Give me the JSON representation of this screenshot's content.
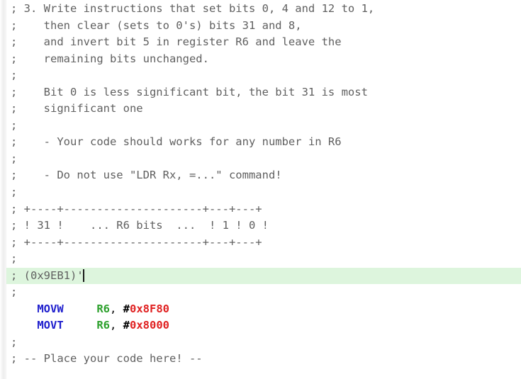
{
  "editor": {
    "name": "assembly-code-editor",
    "language": "ARM Assembly",
    "background_color": "#ffffff",
    "comment_color": "#606060",
    "mnemonic_color": "#1e1ecd",
    "register_color": "#2ca02c",
    "number_color": "#e02020",
    "current_line_highlight_color": "#ddf5dd",
    "caret_visible": true,
    "caret_line_index": 16
  },
  "lines": [
    {
      "id": 0,
      "kind": "comment",
      "text": "; 3. Write instructions that set bits 0, 4 and 12 to 1,"
    },
    {
      "id": 1,
      "kind": "comment",
      "text": ";    then clear (sets to 0's) bits 31 and 8,"
    },
    {
      "id": 2,
      "kind": "comment",
      "text": ";    and invert bit 5 in register R6 and leave the"
    },
    {
      "id": 3,
      "kind": "comment",
      "text": ";    remaining bits unchanged."
    },
    {
      "id": 4,
      "kind": "comment",
      "text": ";"
    },
    {
      "id": 5,
      "kind": "comment",
      "text": ";    Bit 0 is less significant bit, the bit 31 is most"
    },
    {
      "id": 6,
      "kind": "comment",
      "text": ";    significant one"
    },
    {
      "id": 7,
      "kind": "comment",
      "text": ";"
    },
    {
      "id": 8,
      "kind": "comment",
      "text": ";    - Your code should works for any number in R6"
    },
    {
      "id": 9,
      "kind": "comment",
      "text": ";"
    },
    {
      "id": 10,
      "kind": "comment",
      "text": ";    - Do not use \"LDR Rx, =...\" command!"
    },
    {
      "id": 11,
      "kind": "comment",
      "text": ";"
    },
    {
      "id": 12,
      "kind": "comment",
      "text": "; +----+---------------------+---+---+"
    },
    {
      "id": 13,
      "kind": "comment",
      "text": "; ! 31 !    ... R6 bits  ...  ! 1 ! 0 !"
    },
    {
      "id": 14,
      "kind": "comment",
      "text": "; +----+---------------------+---+---+"
    },
    {
      "id": 15,
      "kind": "comment",
      "text": ";"
    },
    {
      "id": 16,
      "kind": "comment-current",
      "text": "; (0x9EB1)'",
      "highlighted": true,
      "caret_after": true
    },
    {
      "id": 17,
      "kind": "comment",
      "text": ";"
    },
    {
      "id": 18,
      "kind": "instruction",
      "indent": "    ",
      "mnemonic": "MOVW",
      "gap": "     ",
      "register": "R6",
      "separator": ", ",
      "hash": "#",
      "operand": "0x8F80"
    },
    {
      "id": 19,
      "kind": "instruction",
      "indent": "    ",
      "mnemonic": "MOVT",
      "gap": "     ",
      "register": "R6",
      "separator": ", ",
      "hash": "#",
      "operand": "0x8000"
    },
    {
      "id": 20,
      "kind": "comment",
      "text": ";"
    },
    {
      "id": 21,
      "kind": "comment",
      "text": "; -- Place your code here! --"
    }
  ]
}
